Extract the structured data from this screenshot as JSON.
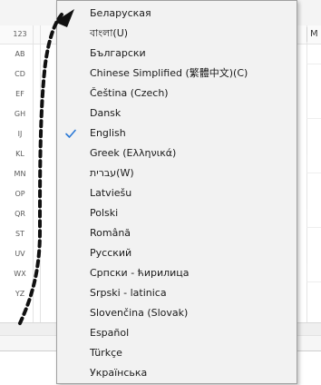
{
  "background": {
    "alpha_index": [
      "123",
      "AB",
      "CD",
      "EF",
      "GH",
      "IJ",
      "KL",
      "MN",
      "OP",
      "QR",
      "ST",
      "UV",
      "WX",
      "YZ"
    ],
    "right_label": "M"
  },
  "menu": {
    "items": [
      {
        "label": "Беларуская",
        "checked": false
      },
      {
        "label": "বাংলা(U)",
        "checked": false
      },
      {
        "label": "Български",
        "checked": false
      },
      {
        "label": "Chinese Simplified (繁體中文)(C)",
        "checked": false
      },
      {
        "label": "Čeština (Czech)",
        "checked": false
      },
      {
        "label": "Dansk",
        "checked": false
      },
      {
        "label": "English",
        "checked": true
      },
      {
        "label": "Greek (Ελληνικά)",
        "checked": false
      },
      {
        "label": "עברית(W)",
        "checked": false
      },
      {
        "label": "Latviešu",
        "checked": false
      },
      {
        "label": "Polski",
        "checked": false
      },
      {
        "label": "Română",
        "checked": false
      },
      {
        "label": "Русский",
        "checked": false
      },
      {
        "label": "Српски - ћирилица",
        "checked": false
      },
      {
        "label": "Srpski - latinica",
        "checked": false
      },
      {
        "label": "Slovenčina (Slovak)",
        "checked": false
      },
      {
        "label": "Español",
        "checked": false
      },
      {
        "label": "Türkçe",
        "checked": false
      },
      {
        "label": "Українська",
        "checked": false
      }
    ]
  },
  "colors": {
    "check": "#2b79d6",
    "menu_bg": "#f2f2f2",
    "annotation": "#111111"
  }
}
